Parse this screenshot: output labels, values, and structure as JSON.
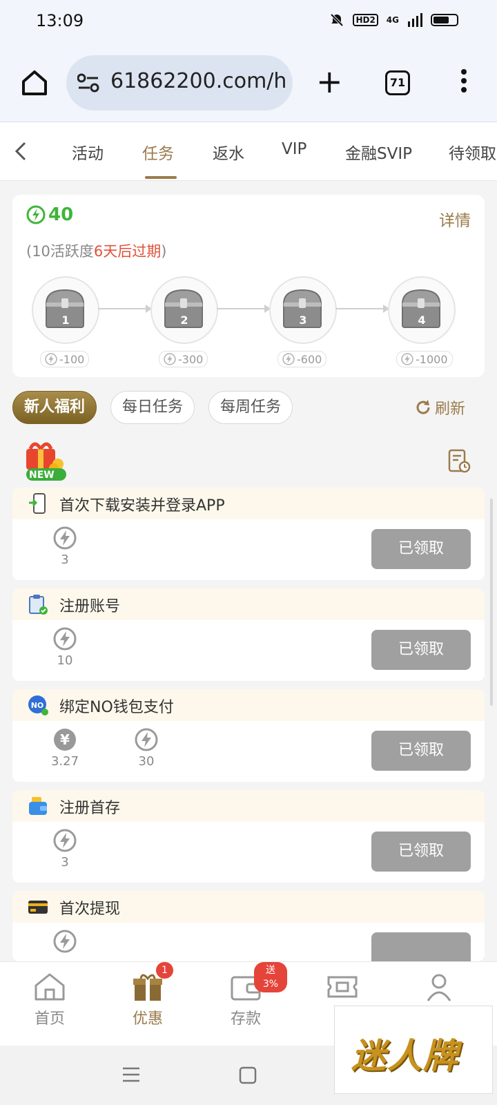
{
  "status": {
    "time": "13:09",
    "hd": "HD2",
    "signal": "4G"
  },
  "browser": {
    "url": "61862200.com/h",
    "tab_count": "71"
  },
  "category_tabs": [
    "活动",
    "任务",
    "返水",
    "VIP",
    "金融SVIP",
    "待领取"
  ],
  "active_category": "任务",
  "activity": {
    "points": "40",
    "detail": "详情",
    "expire_prefix": "(10活跃度",
    "expire_red": "6天后过期",
    "expire_suffix": ")",
    "chests": [
      {
        "num": "1",
        "cost": "-100"
      },
      {
        "num": "2",
        "cost": "-300"
      },
      {
        "num": "3",
        "cost": "-600"
      },
      {
        "num": "4",
        "cost": "-1000"
      }
    ]
  },
  "filters": {
    "tabs": [
      "新人福利",
      "每日任务",
      "每周任务"
    ],
    "active": "新人福利",
    "refresh": "刷新",
    "new_badge": "NEW"
  },
  "tasks": [
    {
      "title": "首次下载安装并登录APP",
      "icon": "phone-download-icon",
      "rewards": [
        {
          "type": "energy",
          "value": "3"
        }
      ],
      "button": "已领取"
    },
    {
      "title": "注册账号",
      "icon": "clipboard-check-icon",
      "rewards": [
        {
          "type": "energy",
          "value": "10"
        }
      ],
      "button": "已领取"
    },
    {
      "title": "绑定NO钱包支付",
      "icon": "no-wallet-icon",
      "rewards": [
        {
          "type": "cash",
          "value": "3.27"
        },
        {
          "type": "energy",
          "value": "30"
        }
      ],
      "button": "已领取"
    },
    {
      "title": "注册首存",
      "icon": "wallet-icon",
      "rewards": [
        {
          "type": "energy",
          "value": "3"
        }
      ],
      "button": "已领取"
    },
    {
      "title": "首次提现",
      "icon": "bank-card-icon",
      "rewards": [
        {
          "type": "energy",
          "value": ""
        }
      ],
      "button": ""
    }
  ],
  "bottom_nav": [
    {
      "label": "首页",
      "icon": "home-icon"
    },
    {
      "label": "优惠",
      "icon": "gift-icon",
      "badge": "1"
    },
    {
      "label": "存款",
      "icon": "wallet-icon",
      "badge": "送3%"
    },
    {
      "label": "",
      "icon": "ticket-icon"
    },
    {
      "label": "",
      "icon": "user-icon"
    }
  ],
  "watermark": "迷人牌",
  "colors": {
    "accent": "#9a7b4c",
    "energy_green": "#3fb539",
    "expire_red": "#e0513a",
    "claimed_gray": "#a0a0a0",
    "task_header": "#fef8ec"
  }
}
